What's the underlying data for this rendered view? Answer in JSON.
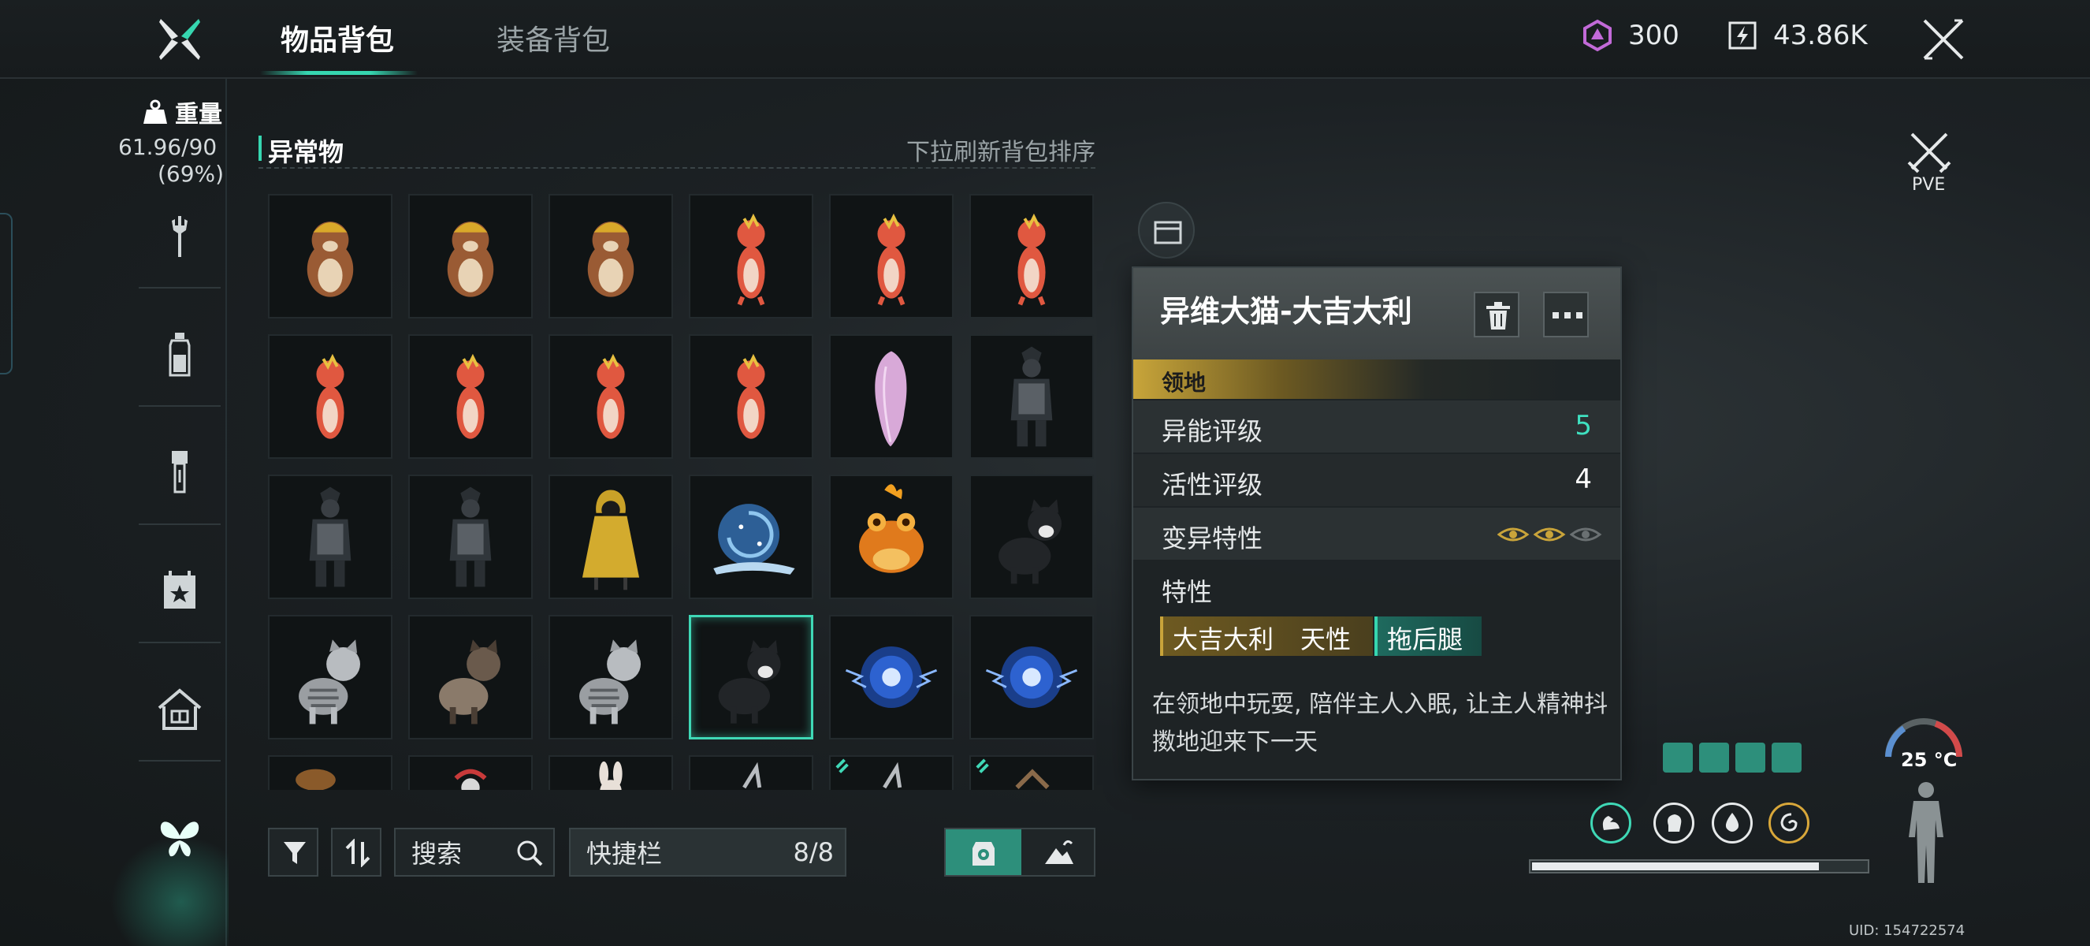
{
  "header": {
    "tabs": [
      {
        "label": "物品背包",
        "active": true
      },
      {
        "label": "装备背包",
        "active": false
      }
    ],
    "currency_premium": "300",
    "currency_energy": "43.86K",
    "accent_color": "#36d6b0"
  },
  "sidebar": {
    "weight_label": "重量",
    "weight_value": "61.96/90",
    "weight_percent": "(69%)",
    "icons": [
      "wrench-icon",
      "bottle-icon",
      "flashlight-icon",
      "calendar-star-icon",
      "home-icon",
      "butterfly-icon"
    ]
  },
  "inventory": {
    "section_title": "异常物",
    "refresh_hint": "下拉刷新背包排序",
    "items": [
      "beaver-hardhat",
      "beaver-hardhat",
      "beaver-hardhat",
      "red-lizard",
      "red-lizard",
      "red-lizard",
      "red-lizard",
      "red-lizard",
      "red-lizard",
      "red-lizard",
      "pink-ghost-hair",
      "samurai-armor",
      "samurai-armor",
      "samurai-armor",
      "yellow-raincoat-doll",
      "blue-snail",
      "orange-frog",
      "black-cat",
      "gray-tabby-cat",
      "siamese-cat",
      "gray-tabby-cat",
      "black-cat-selected",
      "blue-energy-orb",
      "blue-energy-orb"
    ]
  },
  "toolbar": {
    "search_label": "搜索",
    "quickbar_label": "快捷栏",
    "quickbar_count": "8/8"
  },
  "detail": {
    "title": "异维大猫-大吉大利",
    "category": "领地",
    "rows": [
      {
        "label": "异能评级",
        "value": "5"
      },
      {
        "label": "活性评级",
        "value": "4"
      },
      {
        "label": "变异特性",
        "value": ""
      }
    ],
    "mutation_eyes_active": 2,
    "mutation_eyes_total": 3,
    "traits_label": "特性",
    "trait_gold_1": "大吉大利",
    "trait_gold_2": "天性",
    "trait_teal": "拖后腿",
    "description": "在领地中玩耍, 陪伴主人入眠, 让主人精神抖擞地迎来下一天"
  },
  "status": {
    "mode": "PVE",
    "temperature": "25 °C",
    "uid": "UID: 154722574",
    "health_fraction": 0.85
  }
}
